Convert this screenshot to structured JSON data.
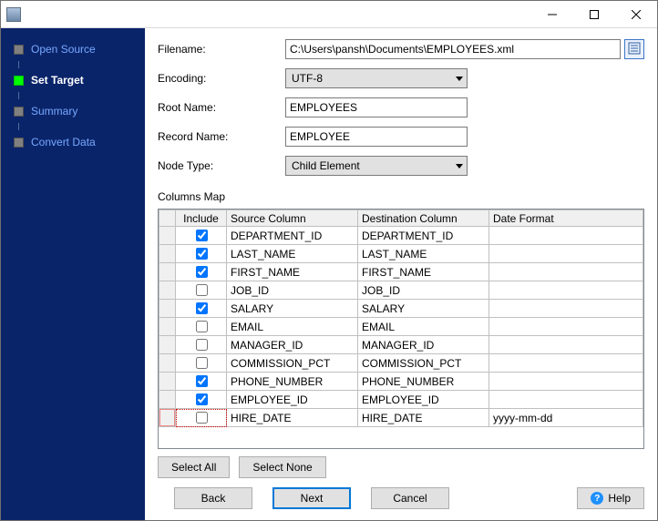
{
  "sidebar": {
    "items": [
      {
        "label": "Open Source",
        "current": false
      },
      {
        "label": "Set Target",
        "current": true
      },
      {
        "label": "Summary",
        "current": false
      },
      {
        "label": "Convert Data",
        "current": false
      }
    ]
  },
  "form": {
    "filename_label": "Filename:",
    "filename_value": "C:\\Users\\pansh\\Documents\\EMPLOYEES.xml",
    "encoding_label": "Encoding:",
    "encoding_value": "UTF-8",
    "root_label": "Root Name:",
    "root_value": "EMPLOYEES",
    "record_label": "Record Name:",
    "record_value": "EMPLOYEE",
    "nodetype_label": "Node Type:",
    "nodetype_value": "Child Element"
  },
  "columns_map": {
    "title": "Columns Map",
    "headers": {
      "include": "Include",
      "source": "Source Column",
      "destination": "Destination Column",
      "date_format": "Date Format"
    },
    "rows": [
      {
        "include": true,
        "source": "DEPARTMENT_ID",
        "destination": "DEPARTMENT_ID",
        "date_format": ""
      },
      {
        "include": true,
        "source": "LAST_NAME",
        "destination": "LAST_NAME",
        "date_format": ""
      },
      {
        "include": true,
        "source": "FIRST_NAME",
        "destination": "FIRST_NAME",
        "date_format": ""
      },
      {
        "include": false,
        "source": "JOB_ID",
        "destination": "JOB_ID",
        "date_format": ""
      },
      {
        "include": true,
        "source": "SALARY",
        "destination": "SALARY",
        "date_format": ""
      },
      {
        "include": false,
        "source": "EMAIL",
        "destination": "EMAIL",
        "date_format": ""
      },
      {
        "include": false,
        "source": "MANAGER_ID",
        "destination": "MANAGER_ID",
        "date_format": ""
      },
      {
        "include": false,
        "source": "COMMISSION_PCT",
        "destination": "COMMISSION_PCT",
        "date_format": ""
      },
      {
        "include": true,
        "source": "PHONE_NUMBER",
        "destination": "PHONE_NUMBER",
        "date_format": ""
      },
      {
        "include": true,
        "source": "EMPLOYEE_ID",
        "destination": "EMPLOYEE_ID",
        "date_format": ""
      },
      {
        "include": false,
        "source": "HIRE_DATE",
        "destination": "HIRE_DATE",
        "date_format": "yyyy-mm-dd"
      }
    ],
    "active_row_index": 10
  },
  "buttons": {
    "select_all": "Select All",
    "select_none": "Select None",
    "back": "Back",
    "next": "Next",
    "cancel": "Cancel",
    "help": "Help"
  }
}
